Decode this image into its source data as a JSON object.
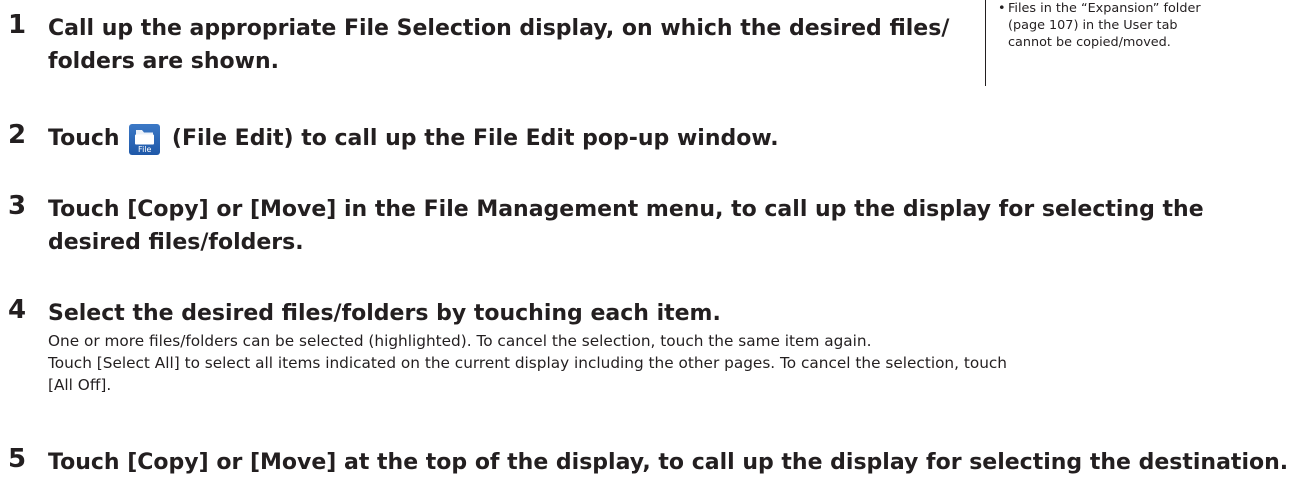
{
  "steps": [
    {
      "number": "1",
      "heading_line1": "Call up the appropriate File Selection display, on which the desired files/",
      "heading_line2": "folders are shown."
    },
    {
      "number": "2",
      "heading_before": "Touch",
      "icon_label": "File",
      "heading_after": "(File Edit) to call up the File Edit pop-up window."
    },
    {
      "number": "3",
      "heading_line1": "Touch [Copy] or [Move] in the File Management menu, to call up the display for selecting the",
      "heading_line2": "desired files/folders."
    },
    {
      "number": "4",
      "heading": "Select the desired files/folders by touching each item.",
      "body_line1": "One or more files/folders can be selected (highlighted). To cancel the selection, touch the same item again.",
      "body_line2": "Touch [Select All] to select all items indicated on the current display including the other pages. To cancel the selection, touch",
      "body_line3": "[All Off]."
    },
    {
      "number": "5",
      "heading": "Touch [Copy] or [Move] at the top of the display, to call up the display for selecting the destination."
    }
  ],
  "note": {
    "bullet": "•",
    "line1": "Files in the “Expansion” folder",
    "line2": "(page 107) in the User tab",
    "line3": "cannot be copied/moved."
  },
  "colors": {
    "text": "#231f20",
    "icon_blue": "#2b66b5"
  }
}
